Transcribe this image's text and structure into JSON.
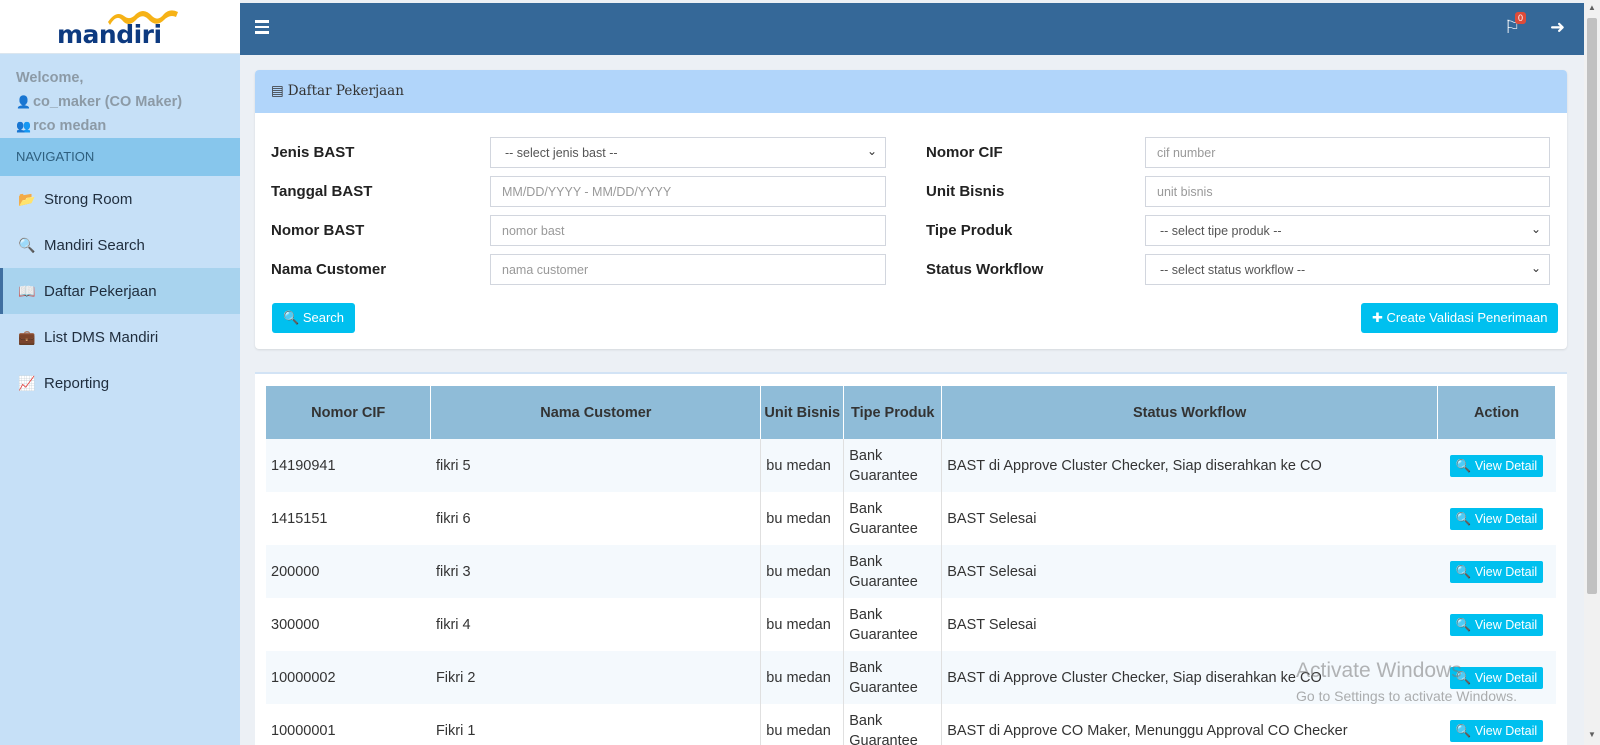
{
  "brand": {
    "logo_text": "mandiri"
  },
  "sidebar": {
    "welcome": "Welcome,",
    "user": "co_maker (CO Maker)",
    "group": "rco medan",
    "nav_header": "NAVIGATION",
    "items": [
      {
        "label": "Strong Room",
        "icon": "folder-open-icon"
      },
      {
        "label": "Mandiri Search",
        "icon": "search-icon"
      },
      {
        "label": "Daftar Pekerjaan",
        "icon": "book-icon",
        "active": true
      },
      {
        "label": "List DMS Mandiri",
        "icon": "briefcase-icon"
      },
      {
        "label": "Reporting",
        "icon": "line-chart-icon"
      }
    ]
  },
  "topbar": {
    "notification_count": "0"
  },
  "panel": {
    "title": "Daftar Pekerjaan",
    "fields": {
      "jenis_bast": {
        "label": "Jenis BAST",
        "value": "-- select jenis bast --"
      },
      "tanggal_bast": {
        "label": "Tanggal BAST",
        "placeholder": "MM/DD/YYYY - MM/DD/YYYY"
      },
      "nomor_bast": {
        "label": "Nomor BAST",
        "placeholder": "nomor bast"
      },
      "nama_customer": {
        "label": "Nama Customer",
        "placeholder": "nama customer"
      },
      "nomor_cif": {
        "label": "Nomor CIF",
        "placeholder": "cif number"
      },
      "unit_bisnis": {
        "label": "Unit Bisnis",
        "placeholder": "unit bisnis"
      },
      "tipe_produk": {
        "label": "Tipe Produk",
        "value": "-- select tipe produk --"
      },
      "status_workflow": {
        "label": "Status Workflow",
        "value": "-- select status workflow --"
      }
    },
    "search_label": "Search",
    "create_label": "Create Validasi Penerimaan"
  },
  "table": {
    "headers": {
      "cif": "Nomor CIF",
      "name": "Nama Customer",
      "unit": "Unit Bisnis",
      "product": "Tipe Produk",
      "status": "Status Workflow",
      "action": "Action"
    },
    "rows": [
      {
        "cif": "14190941",
        "name": "fikri 5",
        "unit": "bu medan",
        "product": "Bank Guarantee",
        "status": "BAST di Approve Cluster Checker, Siap diserahkan ke CO",
        "action": "View Detail"
      },
      {
        "cif": "1415151",
        "name": "fikri 6",
        "unit": "bu medan",
        "product": "Bank Guarantee",
        "status": "BAST Selesai",
        "action": "View Detail"
      },
      {
        "cif": "200000",
        "name": "fikri 3",
        "unit": "bu medan",
        "product": "Bank Guarantee",
        "status": "BAST Selesai",
        "action": "View Detail"
      },
      {
        "cif": "300000",
        "name": "fikri 4",
        "unit": "bu medan",
        "product": "Bank Guarantee",
        "status": "BAST Selesai",
        "action": "View Detail"
      },
      {
        "cif": "10000002",
        "name": "Fikri 2",
        "unit": "bu medan",
        "product": "Bank Guarantee",
        "status": "BAST di Approve Cluster Checker, Siap diserahkan ke CO",
        "action": "View Detail"
      },
      {
        "cif": "10000001",
        "name": "Fikri 1",
        "unit": "bu medan",
        "product": "Bank Guarantee",
        "status": "BAST di Approve CO Maker, Menunggu Approval CO Checker",
        "action": "View Detail"
      }
    ]
  },
  "watermark": {
    "title": "Activate Windows",
    "subtitle": "Go to Settings to activate Windows."
  }
}
